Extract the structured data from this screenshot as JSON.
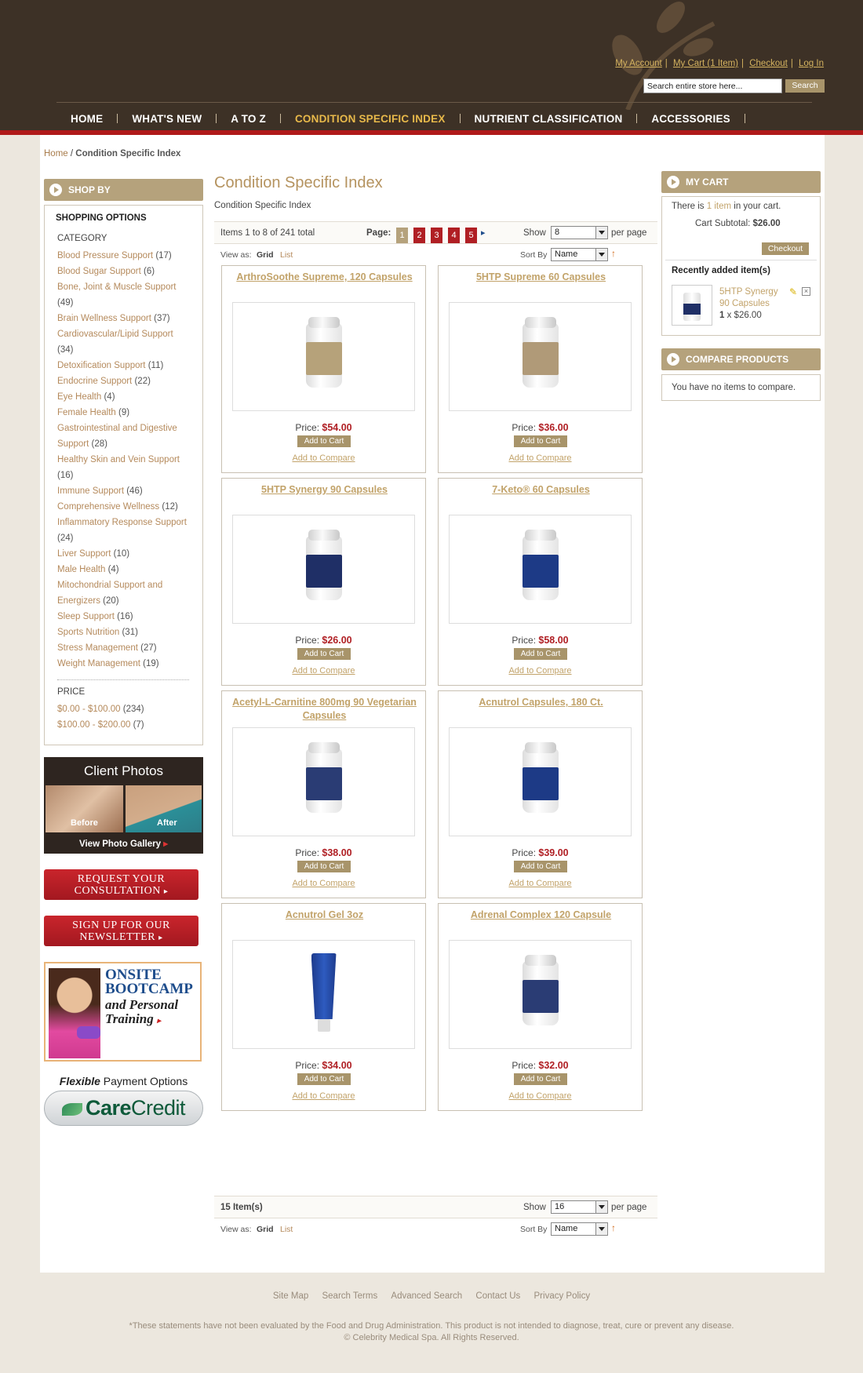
{
  "header": {
    "contact_line1": "",
    "contact_line2": "",
    "links": [
      "My Account",
      "My Cart (1 Item)",
      "Checkout",
      "Log In"
    ],
    "search_placeholder": "Search entire store here...",
    "search_button": "Search"
  },
  "nav": [
    "HOME",
    "WHAT'S NEW",
    "A TO Z",
    "CONDITION SPECIFIC INDEX",
    "NUTRIENT CLASSIFICATION",
    "ACCESSORIES"
  ],
  "breadcrumb": {
    "home": "Home",
    "sep": " / ",
    "current": "Condition Specific Index"
  },
  "sidebar": {
    "shop_by": "SHOP BY",
    "shopping_options": "SHOPPING OPTIONS",
    "category_label": "CATEGORY",
    "categories": [
      {
        "label": "Blood Pressure Support",
        "count": "(17)"
      },
      {
        "label": "Blood Sugar Support",
        "count": "(6)"
      },
      {
        "label": "Bone, Joint & Muscle Support",
        "count": "(49)"
      },
      {
        "label": "Brain Wellness Support",
        "count": "(37)"
      },
      {
        "label": "Cardiovascular/Lipid Support",
        "count": "(34)"
      },
      {
        "label": "Detoxification Support",
        "count": "(11)"
      },
      {
        "label": "Endocrine Support",
        "count": "(22)"
      },
      {
        "label": "Eye Health",
        "count": "(4)"
      },
      {
        "label": "Female Health",
        "count": "(9)"
      },
      {
        "label": "Gastrointestinal and Digestive Support",
        "count": "(28)"
      },
      {
        "label": "Healthy Skin and Vein Support",
        "count": "(16)"
      },
      {
        "label": "Immune Support",
        "count": "(46)"
      },
      {
        "label": "Comprehensive Wellness",
        "count": "(12)"
      },
      {
        "label": "Inflammatory Response Support",
        "count": "(24)"
      },
      {
        "label": "Liver Support",
        "count": "(10)"
      },
      {
        "label": "Male Health",
        "count": "(4)"
      },
      {
        "label": "Mitochondrial Support and Energizers",
        "count": "(20)"
      },
      {
        "label": "Sleep Support",
        "count": "(16)"
      },
      {
        "label": "Sports Nutrition",
        "count": "(31)"
      },
      {
        "label": "Stress Management",
        "count": "(27)"
      },
      {
        "label": "Weight Management",
        "count": "(19)"
      }
    ],
    "price_label": "PRICE",
    "prices": [
      {
        "label": "$0.00 - $100.00",
        "count": "(234)"
      },
      {
        "label": "$100.00 - $200.00",
        "count": "(7)"
      }
    ],
    "client_photos": {
      "title": "Client Photos",
      "before": "Before",
      "after": "After",
      "gallery": "View Photo Gallery"
    },
    "request_consultation": [
      "REQUEST YOUR",
      "CONSULTATION"
    ],
    "newsletter": [
      "SIGN UP FOR OUR",
      "NEWSLETTER"
    ],
    "bootcamp": {
      "line1": "ONSITE",
      "line2": "BOOTCAMP",
      "line3": "and Personal",
      "line4": "Training"
    },
    "flexible": {
      "bold": "Flexible",
      "rest": " Payment Options"
    },
    "carecredit": {
      "care": "Care",
      "credit": "Credit"
    }
  },
  "main": {
    "title": "Condition Specific Index",
    "subtitle": "Condition Specific Index",
    "toolbar_top": {
      "items_text": "Items 1 to 8 of 241 total",
      "page_label": "Page:",
      "pages": [
        "1",
        "2",
        "3",
        "4",
        "5"
      ],
      "current_page": "1",
      "show_label": "Show",
      "show_value": "8",
      "per_page": "per page",
      "view_as": "View as:",
      "grid": "Grid",
      "list": "List",
      "sort_by": "Sort By",
      "sort_value": "Name"
    },
    "toolbar_bottom": {
      "items_text": "15 Item(s)",
      "show_label": "Show",
      "show_value": "16",
      "per_page": "per page",
      "view_as": "View as:",
      "grid": "Grid",
      "list": "List",
      "sort_by": "Sort By",
      "sort_value": "Name"
    },
    "price_label": "Price:",
    "add_to_cart": "Add to Cart",
    "add_to_compare": "Add to Compare",
    "products": [
      {
        "name": "ArthroSoothe Supreme, 120 Capsules",
        "price": "$54.00",
        "label_color": "#b6a27a"
      },
      {
        "name": "5HTP Supreme 60 Capsules",
        "price": "$36.00",
        "label_color": "#b09a78"
      },
      {
        "name": "5HTP Synergy 90 Capsules",
        "price": "$26.00",
        "label_color": "#1f2f66"
      },
      {
        "name": "7-Keto® 60 Capsules",
        "price": "$58.00",
        "label_color": "#1d3a86"
      },
      {
        "name": "Acetyl-L-Carnitine 800mg 90 Vegetarian Capsules",
        "price": "$38.00",
        "label_color": "#2a3c74"
      },
      {
        "name": "Acnutrol Capsules, 180 Ct.",
        "price": "$39.00",
        "label_color": "#1d3a86"
      },
      {
        "name": "Acnutrol Gel 3oz",
        "price": "$34.00",
        "label_color": "tube"
      },
      {
        "name": "Adrenal Complex 120 Capsule",
        "price": "$32.00",
        "label_color": "#2a3c74"
      }
    ]
  },
  "right": {
    "my_cart": "MY CART",
    "cart_text_pre": "There is ",
    "cart_text_link": "1 item",
    "cart_text_post": " in your cart.",
    "subtotal_label": "Cart Subtotal: ",
    "subtotal_value": "$26.00",
    "checkout": "Checkout",
    "recently": "Recently added item(s)",
    "recent_item": {
      "name": "5HTP Synergy 90 Capsules",
      "qty": "1",
      "x": " x ",
      "price": "$26.00"
    },
    "compare_title": "COMPARE PRODUCTS",
    "compare_text": "You have no items to compare."
  },
  "footer": {
    "links": [
      "Site Map",
      "Search Terms",
      "Advanced Search",
      "Contact Us",
      "Privacy Policy"
    ],
    "disclaimer": "*These statements have not been evaluated by the Food and Drug Administration. This product is not intended to diagnose, treat, cure or prevent any disease.",
    "copyright": "© Celebrity Medical Spa. All Rights Reserved."
  }
}
